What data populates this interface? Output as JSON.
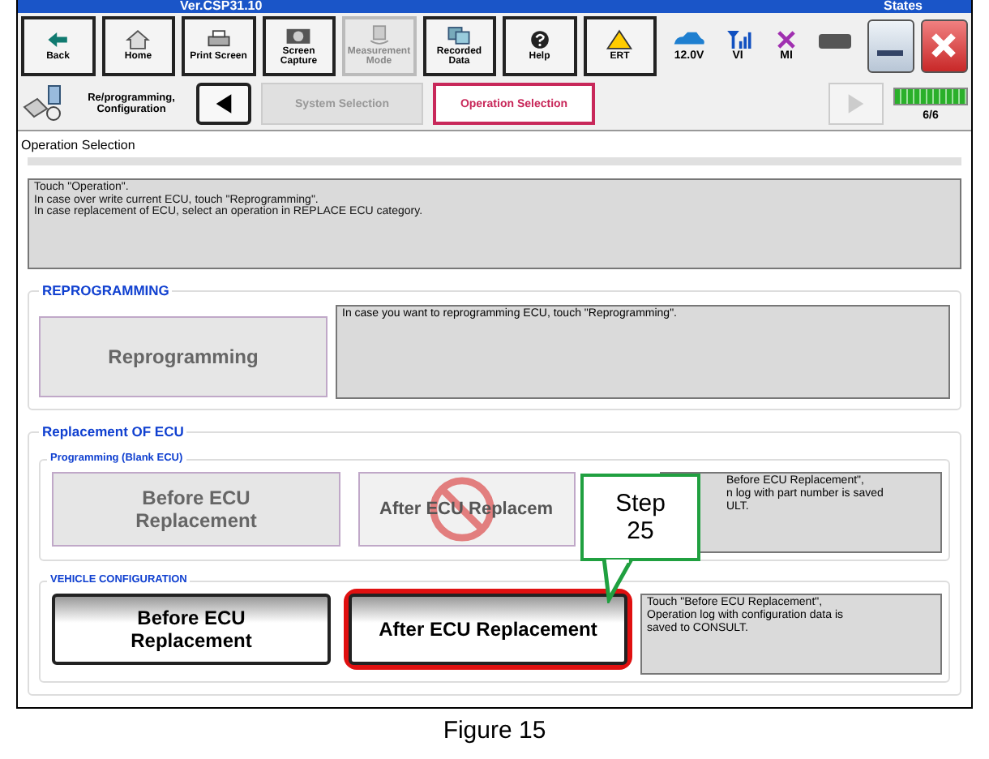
{
  "header": {
    "version": "Ver.CSP31.10",
    "states": "States"
  },
  "toolbar": [
    {
      "label": "Back",
      "disabled": false
    },
    {
      "label": "Home",
      "disabled": false
    },
    {
      "label": "Print Screen",
      "disabled": false
    },
    {
      "label": "Screen Capture",
      "disabled": false
    },
    {
      "label": "Measurement Mode",
      "disabled": true
    },
    {
      "label": "Recorded Data",
      "disabled": false
    },
    {
      "label": "Help",
      "disabled": false
    },
    {
      "label": "ERT",
      "disabled": false
    }
  ],
  "status": [
    {
      "label": "12.0V"
    },
    {
      "label": "VI"
    },
    {
      "label": "MI"
    }
  ],
  "breadcrumb": {
    "title": "Re/programming, Configuration",
    "steps": [
      {
        "label": "System Selection",
        "selected": false
      },
      {
        "label": "Operation Selection",
        "selected": true
      }
    ],
    "progress": {
      "label": "6/6",
      "level": 1
    }
  },
  "page_title": "Operation Selection",
  "info": [
    "Touch  \"Operation\".",
    "In case over write current ECU, touch \"Reprogramming\".",
    "In case replacement of ECU, select an operation in REPLACE ECU category."
  ],
  "reprogramming": {
    "title": "REPROGRAMMING",
    "button": {
      "label": "Reprogramming",
      "disabled": true
    },
    "description": "In case you want to reprogramming ECU, touch \"Reprogramming\"."
  },
  "replacement": {
    "title": "Replacement OF ECU",
    "groups": [
      {
        "title": "Programming (Blank ECU)",
        "buttons": [
          {
            "label": "Before ECU Replacement",
            "disabled": true,
            "highlighted": false,
            "prohibited": false
          },
          {
            "label": "After ECU Replacem",
            "disabled": true,
            "highlighted": false,
            "prohibited": true
          }
        ],
        "description": [
          "Before ECU Replacement\",",
          "n log with part number is saved",
          "ULT."
        ]
      },
      {
        "title": "VEHICLE CONFIGURATION",
        "buttons": [
          {
            "label": "Before ECU Replacement",
            "disabled": false,
            "highlighted": false,
            "prohibited": false
          },
          {
            "label": "After ECU Replacement",
            "disabled": false,
            "highlighted": true,
            "prohibited": false
          }
        ],
        "description": [
          "Touch \"Before ECU Replacement\",",
          "Operation log with configuration data is",
          "saved to CONSULT."
        ]
      }
    ]
  },
  "callout": {
    "text": "Step 25"
  },
  "caption": "Figure 15"
}
